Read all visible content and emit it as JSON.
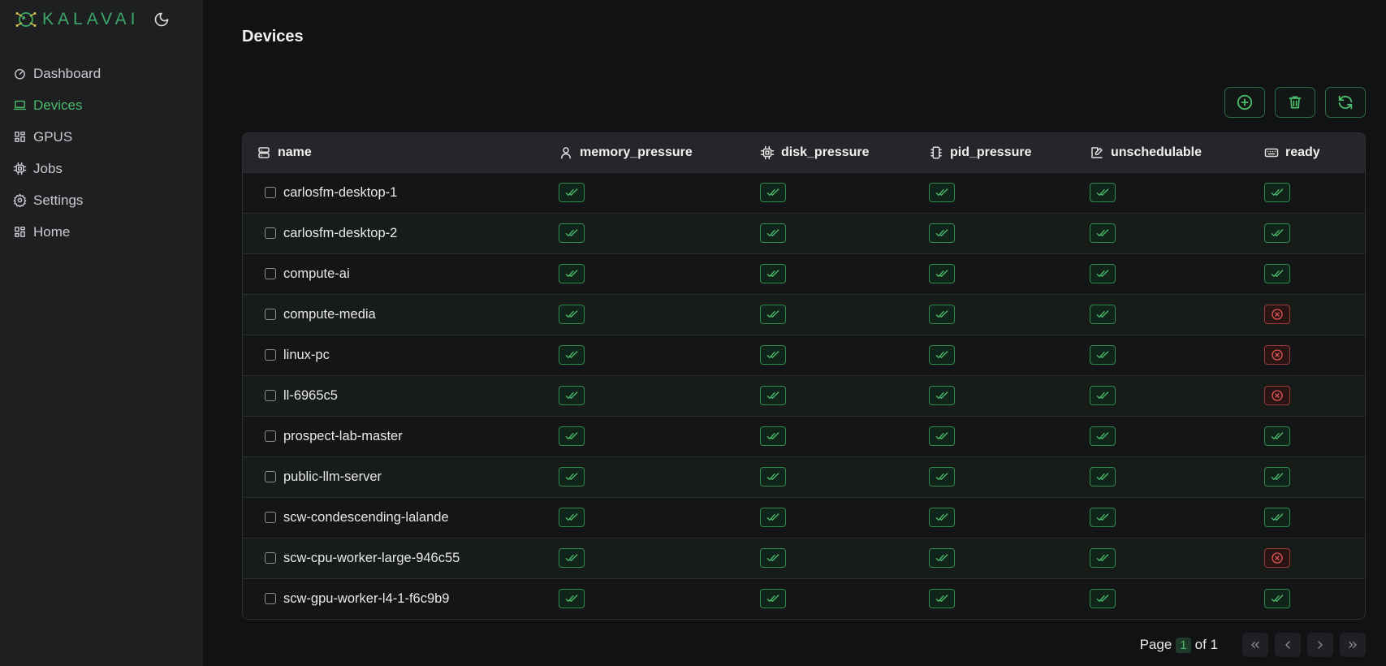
{
  "app": {
    "logo_text": "KALAVAI"
  },
  "sidebar": {
    "items": [
      {
        "label": "Dashboard",
        "icon": "gauge-icon"
      },
      {
        "label": "Devices",
        "icon": "laptop-icon",
        "active": true
      },
      {
        "label": "GPUS",
        "icon": "grid-icon"
      },
      {
        "label": "Jobs",
        "icon": "cpu-icon"
      },
      {
        "label": "Settings",
        "icon": "gear-icon"
      },
      {
        "label": "Home",
        "icon": "grid-icon"
      }
    ]
  },
  "page": {
    "title": "Devices"
  },
  "toolbar": {
    "buttons": [
      "add-icon",
      "trash-icon",
      "refresh-icon"
    ]
  },
  "table": {
    "columns": [
      {
        "label": "name",
        "icon": "server-icon"
      },
      {
        "label": "memory_pressure",
        "icon": "user-icon"
      },
      {
        "label": "disk_pressure",
        "icon": "cpu-icon"
      },
      {
        "label": "pid_pressure",
        "icon": "chip-icon"
      },
      {
        "label": "unschedulable",
        "icon": "edit-icon"
      },
      {
        "label": "ready",
        "icon": "keyboard-icon"
      }
    ],
    "rows": [
      {
        "name": "carlosfm-desktop-1",
        "ready": true
      },
      {
        "name": "carlosfm-desktop-2",
        "ready": true
      },
      {
        "name": "compute-ai",
        "ready": true
      },
      {
        "name": "compute-media",
        "ready": false
      },
      {
        "name": "linux-pc",
        "ready": false
      },
      {
        "name": "ll-6965c5",
        "ready": false
      },
      {
        "name": "prospect-lab-master",
        "ready": true
      },
      {
        "name": "public-llm-server",
        "ready": true
      },
      {
        "name": "scw-condescending-lalande",
        "ready": true
      },
      {
        "name": "scw-cpu-worker-large-946c55",
        "ready": false
      },
      {
        "name": "scw-gpu-worker-l4-1-f6c9b9",
        "ready": true
      }
    ]
  },
  "pagination": {
    "prefix": "Page",
    "current": "1",
    "suffix": "of 1"
  },
  "colors": {
    "accent": "#4cbc6c",
    "danger": "#e05555",
    "background": "#111214",
    "sidebar": "#1d1f21"
  }
}
